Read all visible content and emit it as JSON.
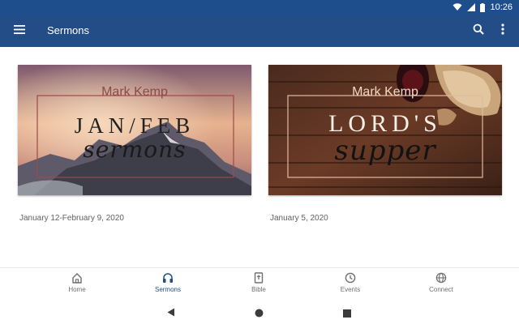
{
  "status_bar": {
    "time": "10:26"
  },
  "app_bar": {
    "title": "Sermons"
  },
  "cards": [
    {
      "author": "Mark Kemp",
      "line1": "JAN/FEB",
      "line2": "sermons",
      "date": "January 12-February 9, 2020"
    },
    {
      "author": "Mark Kemp",
      "line1": "LORD'S",
      "line2": "supper",
      "date": "January 5, 2020"
    }
  ],
  "bottom_nav": {
    "items": [
      {
        "label": "Home",
        "icon": "home-icon"
      },
      {
        "label": "Sermons",
        "icon": "headphones-icon",
        "active": true
      },
      {
        "label": "Bible",
        "icon": "bible-icon"
      },
      {
        "label": "Events",
        "icon": "clock-icon"
      },
      {
        "label": "Connect",
        "icon": "globe-icon"
      }
    ]
  },
  "colors": {
    "primary": "#234d86",
    "status_bar": "#1f4e8c",
    "inactive": "#6f6f6f"
  }
}
